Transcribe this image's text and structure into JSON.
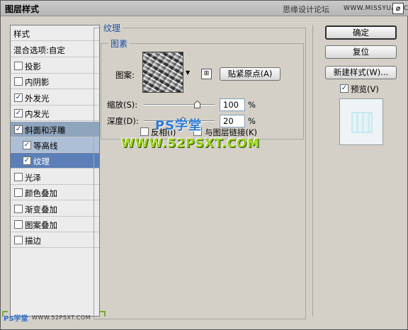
{
  "window": {
    "title": "图层样式",
    "watermark_site": "思缘设计论坛",
    "watermark_url": "WWW.MISSYUAN.COM",
    "close_glyph": "⌀"
  },
  "left_panel": {
    "header": "样式",
    "blend_options": "混合选项:自定",
    "items": [
      {
        "label": "投影",
        "checked": false
      },
      {
        "label": "内阴影",
        "checked": false
      },
      {
        "label": "外发光",
        "checked": true
      },
      {
        "label": "内发光",
        "checked": true
      },
      {
        "label": "斜面和浮雕",
        "checked": true
      },
      {
        "label": "等高线",
        "checked": true
      },
      {
        "label": "纹理",
        "checked": true
      },
      {
        "label": "光泽",
        "checked": false
      },
      {
        "label": "颜色叠加",
        "checked": false
      },
      {
        "label": "渐变叠加",
        "checked": false
      },
      {
        "label": "图案叠加",
        "checked": false
      },
      {
        "label": "描边",
        "checked": false
      }
    ],
    "check_glyph": "✓"
  },
  "texture": {
    "group_title": "纹理",
    "subgroup_title": "图素",
    "pattern_label": "图案:",
    "snap_button": "贴紧原点(A)",
    "scale_label": "缩放(S):",
    "scale_value": "100",
    "scale_percent": 0.75,
    "depth_label": "深度(D):",
    "depth_value": "20",
    "depth_percent": 0.55,
    "percent_sign": "%",
    "invert_label": "反相(I)",
    "link_label": "与图层链接(K)",
    "invert_checked": false,
    "link_checked": false
  },
  "buttons": {
    "ok": "确定",
    "reset": "复位",
    "new_style": "新建样式(W)...",
    "preview_label": "预览(V)",
    "preview_checked": true
  },
  "watermarks": {
    "ps_school": "PS学堂",
    "site_url": "WWW.52PSXT.COM",
    "bottom_ps": "PS学堂",
    "bottom_url": "WWW.52PSXT.COM"
  }
}
